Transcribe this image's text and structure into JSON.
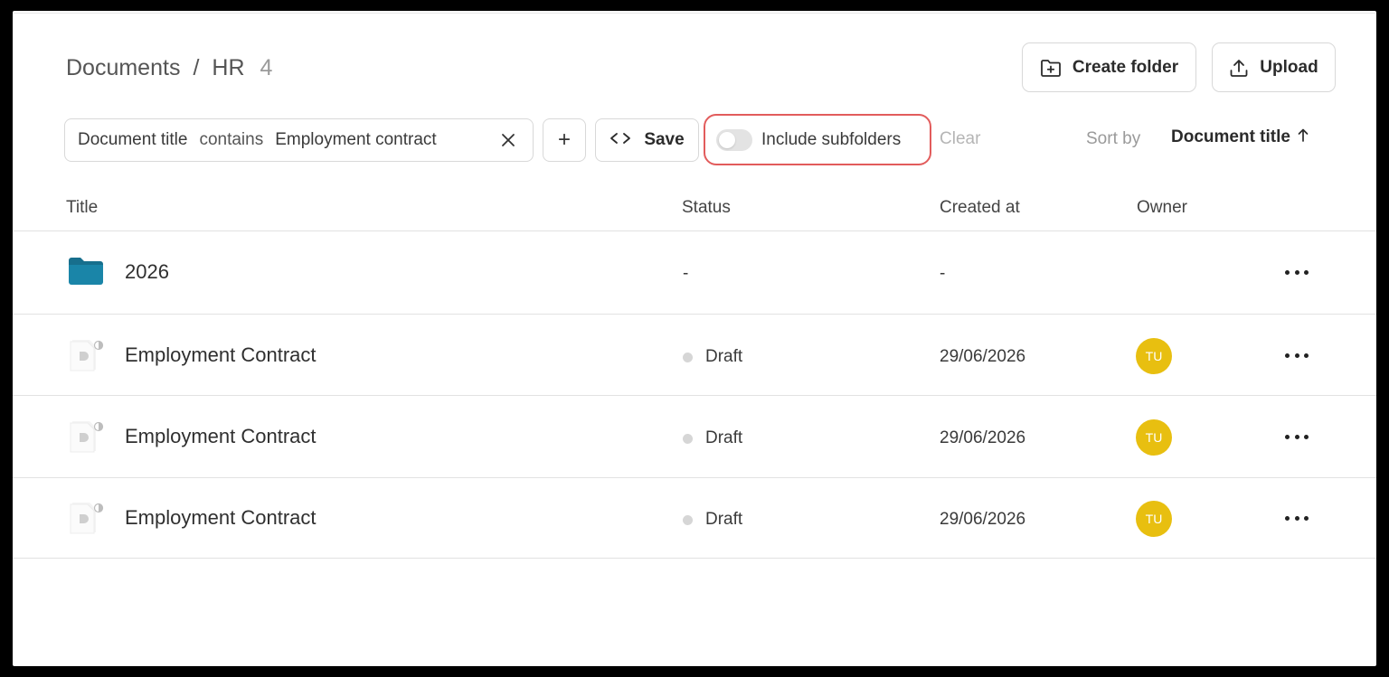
{
  "header": {
    "breadcrumb": {
      "root": "Documents",
      "separator": "/",
      "current": "HR",
      "count": "4"
    },
    "create_folder_label": "Create folder",
    "upload_label": "Upload"
  },
  "filters": {
    "field": "Document title",
    "operator": "contains",
    "value": "Employment contract",
    "add_label": "+",
    "save_label": "Save",
    "include_subfolders_label": "Include subfolders",
    "include_subfolders_on": false,
    "clear_label": "Clear"
  },
  "sort": {
    "label": "Sort by",
    "value": "Document title",
    "direction_icon": "arrow-up-icon"
  },
  "table": {
    "columns": {
      "title": "Title",
      "status": "Status",
      "created": "Created at",
      "owner": "Owner"
    },
    "rows": [
      {
        "type": "folder",
        "name": "2026",
        "status": "-",
        "created": "-",
        "owner": ""
      },
      {
        "type": "document",
        "name": "Employment Contract",
        "status": "Draft",
        "created": "29/06/2026",
        "owner": "TU"
      },
      {
        "type": "document",
        "name": "Employment Contract",
        "status": "Draft",
        "created": "29/06/2026",
        "owner": "TU"
      },
      {
        "type": "document",
        "name": "Employment Contract",
        "status": "Draft",
        "created": "29/06/2026",
        "owner": "TU"
      }
    ]
  },
  "colors": {
    "folder": "#1a7fa0",
    "avatar": "#e8bf10",
    "highlight": "#e25c5c",
    "status_draft": "#d6d6d6"
  }
}
